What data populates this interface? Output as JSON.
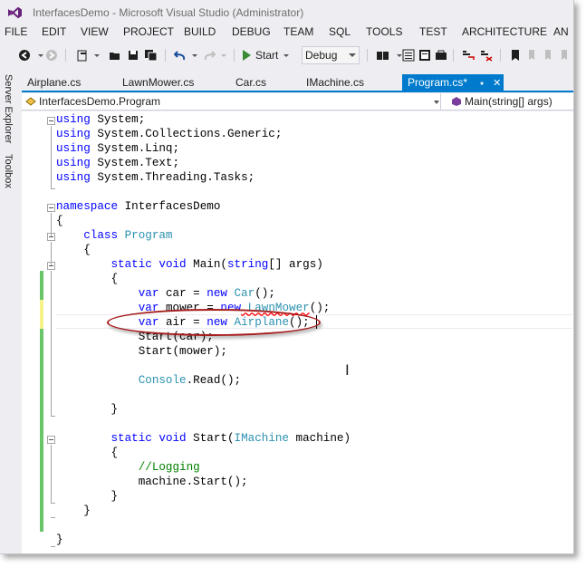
{
  "window": {
    "title": "InterfacesDemo - Microsoft Visual Studio (Administrator)"
  },
  "menu": [
    "FILE",
    "EDIT",
    "VIEW",
    "PROJECT",
    "BUILD",
    "DEBUG",
    "TEAM",
    "SQL",
    "TOOLS",
    "TEST",
    "ARCHITECTURE",
    "AN"
  ],
  "toolbar": {
    "icons": [
      "back-icon",
      "forward-icon",
      "new-project-icon",
      "open-file-icon",
      "save-icon",
      "save-all-icon",
      "undo-icon",
      "redo-icon",
      "start-icon",
      "find-in-files-icon",
      "solution-explorer-icon",
      "properties-icon",
      "comment-icon",
      "uncomment-icon",
      "bookmark-icon",
      "prev-bookmark-icon",
      "next-bookmark-icon",
      "clear-bookmarks-icon"
    ],
    "start_label": "Start",
    "config_value": "Debug"
  },
  "side_tabs": [
    "Server Explorer",
    "Toolbox"
  ],
  "tabs": [
    {
      "label": "Airplane.cs",
      "active": false
    },
    {
      "label": "LawnMower.cs",
      "active": false
    },
    {
      "label": "Car.cs",
      "active": false
    },
    {
      "label": "IMachine.cs",
      "active": false
    },
    {
      "label": "Program.cs*",
      "active": true
    }
  ],
  "navbar": {
    "type": "InterfacesDemo.Program",
    "member": "Main(string[] args)"
  },
  "code": {
    "lines": [
      [
        [
          "kw",
          "using"
        ],
        [
          "",
          "System;"
        ]
      ],
      [
        [
          "kw",
          "using"
        ],
        [
          "",
          "System.Collections.Generic;"
        ]
      ],
      [
        [
          "kw",
          "using"
        ],
        [
          "",
          "System.Linq;"
        ]
      ],
      [
        [
          "kw",
          "using"
        ],
        [
          "",
          "System.Text;"
        ]
      ],
      [
        [
          "kw",
          "using"
        ],
        [
          "",
          "System.Threading.Tasks;"
        ]
      ],
      [],
      [
        [
          "kw",
          "namespace"
        ],
        [
          "",
          "InterfacesDemo"
        ]
      ],
      [
        [
          "",
          "{"
        ]
      ],
      [
        [
          "",
          "    "
        ],
        [
          "kw",
          "class"
        ],
        [
          "ty",
          " Program"
        ]
      ],
      [
        [
          "",
          "    {"
        ]
      ],
      [
        [
          "",
          "        "
        ],
        [
          "kw",
          "static"
        ],
        [
          "",
          ""
        ],
        [
          "kw",
          " void"
        ],
        [
          "",
          " Main("
        ],
        [
          "kw",
          "string"
        ],
        [
          "",
          "[] args)"
        ]
      ],
      [
        [
          "",
          "        {"
        ]
      ],
      [
        [
          "",
          "            "
        ],
        [
          "kw",
          "var"
        ],
        [
          "",
          " car = "
        ],
        [
          "kw",
          "new"
        ],
        [
          "ty",
          " Car"
        ],
        [
          "",
          "();"
        ]
      ],
      [
        [
          "",
          "            "
        ],
        [
          "kw",
          "var"
        ],
        [
          "",
          " mower = "
        ],
        [
          "kw",
          "new"
        ],
        [
          "squigty",
          " LawnMower"
        ],
        [
          "",
          "();"
        ]
      ],
      [
        [
          "",
          "            "
        ],
        [
          "kw",
          "var"
        ],
        [
          "",
          " air = "
        ],
        [
          "kw",
          "new"
        ],
        [
          "ty",
          " Airplane"
        ],
        [
          "",
          "();"
        ]
      ],
      [
        [
          "",
          "            Start(car);"
        ]
      ],
      [
        [
          "",
          "            Start(mower);"
        ]
      ],
      [],
      [
        [
          "",
          "            "
        ],
        [
          "ty",
          "Console"
        ],
        [
          "",
          ".Read();"
        ]
      ],
      [],
      [
        [
          "",
          "        }"
        ]
      ],
      [],
      [
        [
          "",
          "        "
        ],
        [
          "kw",
          "static"
        ],
        [
          "kw",
          " void"
        ],
        [
          "",
          " Start("
        ],
        [
          "ty",
          "IMachine"
        ],
        [
          "",
          " machine)"
        ]
      ],
      [
        [
          "",
          "        {"
        ]
      ],
      [
        [
          "",
          "            "
        ],
        [
          "cm",
          "//Logging"
        ]
      ],
      [
        [
          "",
          "            machine.Start();"
        ]
      ],
      [
        [
          "",
          "        }"
        ]
      ],
      [
        [
          "",
          "    }"
        ]
      ],
      [],
      [
        [
          "",
          "}"
        ]
      ]
    ]
  },
  "colors": {
    "tab_active": "#007acc",
    "keyword": "#0000ff",
    "type": "#2b91af",
    "comment": "#008000",
    "change_saved": "#6ac46a",
    "change_unsaved": "#f5f28a",
    "annotation_ellipse": "#a51c1c"
  }
}
